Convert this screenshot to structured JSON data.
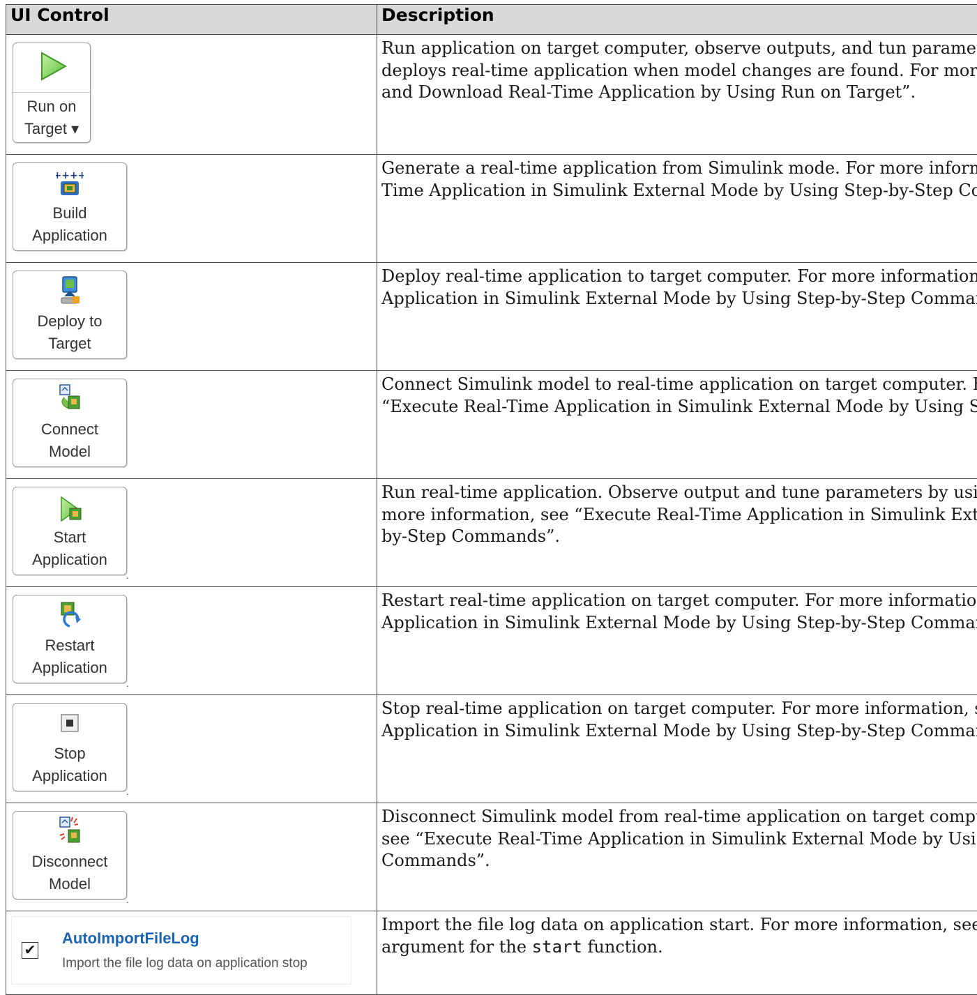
{
  "table": {
    "headers": [
      "UI Control",
      "Description"
    ],
    "rows": [
      {
        "control": {
          "type": "button",
          "icon": "run-on-target-icon",
          "label_line1": "Run on",
          "label_line2": "Target ▾"
        },
        "description": [
          "Run application on target computer, observe outputs, and tun paramet",
          "deploys real-time application when model changes are found. For mor",
          "and Download Real-Time Application by Using Run on Target”."
        ]
      },
      {
        "control": {
          "type": "button",
          "icon": "build-application-icon",
          "label_line1": "Build",
          "label_line2": "Application"
        },
        "description": [
          "Generate a real-time application from Simulink mode. For more inform",
          "Time Application in Simulink External Mode by Using Step-by-Step Co"
        ]
      },
      {
        "control": {
          "type": "button",
          "icon": "deploy-to-target-icon",
          "label_line1": "Deploy to",
          "label_line2": "Target"
        },
        "description": [
          "Deploy real-time application to target computer. For more information",
          "Application in Simulink External Mode by Using Step-by-Step Comman"
        ]
      },
      {
        "control": {
          "type": "button",
          "icon": "connect-model-icon",
          "label_line1": "Connect",
          "label_line2": "Model"
        },
        "description": [
          "Connect Simulink model to real-time application on target computer. F",
          "“Execute Real-Time Application in Simulink External Mode by Using S"
        ]
      },
      {
        "control": {
          "type": "button",
          "icon": "start-application-icon",
          "label_line1": "Start",
          "label_line2": "Application"
        },
        "description": [
          "Run real-time application. Observe output and tune parameters by usi",
          "more information, see “Execute Real-Time Application in Simulink Ext",
          "by-Step Commands”."
        ]
      },
      {
        "control": {
          "type": "button",
          "icon": "restart-application-icon",
          "label_line1": "Restart",
          "label_line2": "Application"
        },
        "description": [
          "Restart real-time application on target computer. For more informatio",
          "Application in Simulink External Mode by Using Step-by-Step Comman"
        ]
      },
      {
        "control": {
          "type": "button",
          "icon": "stop-application-icon",
          "label_line1": "Stop",
          "label_line2": "Application"
        },
        "description": [
          "Stop real-time application on target computer. For more information, s",
          "Application in Simulink External Mode by Using Step-by-Step Comman"
        ]
      },
      {
        "control": {
          "type": "button",
          "icon": "disconnect-model-icon",
          "label_line1": "Disconnect",
          "label_line2": "Model"
        },
        "description": [
          "Disconnect Simulink model from real-time application on target compu",
          "see “Execute Real-Time Application in Simulink External Mode by Usi",
          "Commands”."
        ]
      },
      {
        "control": {
          "type": "checkbox",
          "icon": "checkmark-icon",
          "name": "AutoImportFileLog",
          "subtext": "Import the file log data on application stop",
          "checked": true
        },
        "description_parts": {
          "line1": "Import the file log data on application start. For more information, see",
          "line2_before": "argument for the ",
          "line2_code": "start",
          "line2_after": " function."
        }
      }
    ]
  },
  "colors": {
    "header_bg": "#d9d9d9",
    "link_blue": "#1a64b4",
    "border": "#4a4a4a"
  }
}
